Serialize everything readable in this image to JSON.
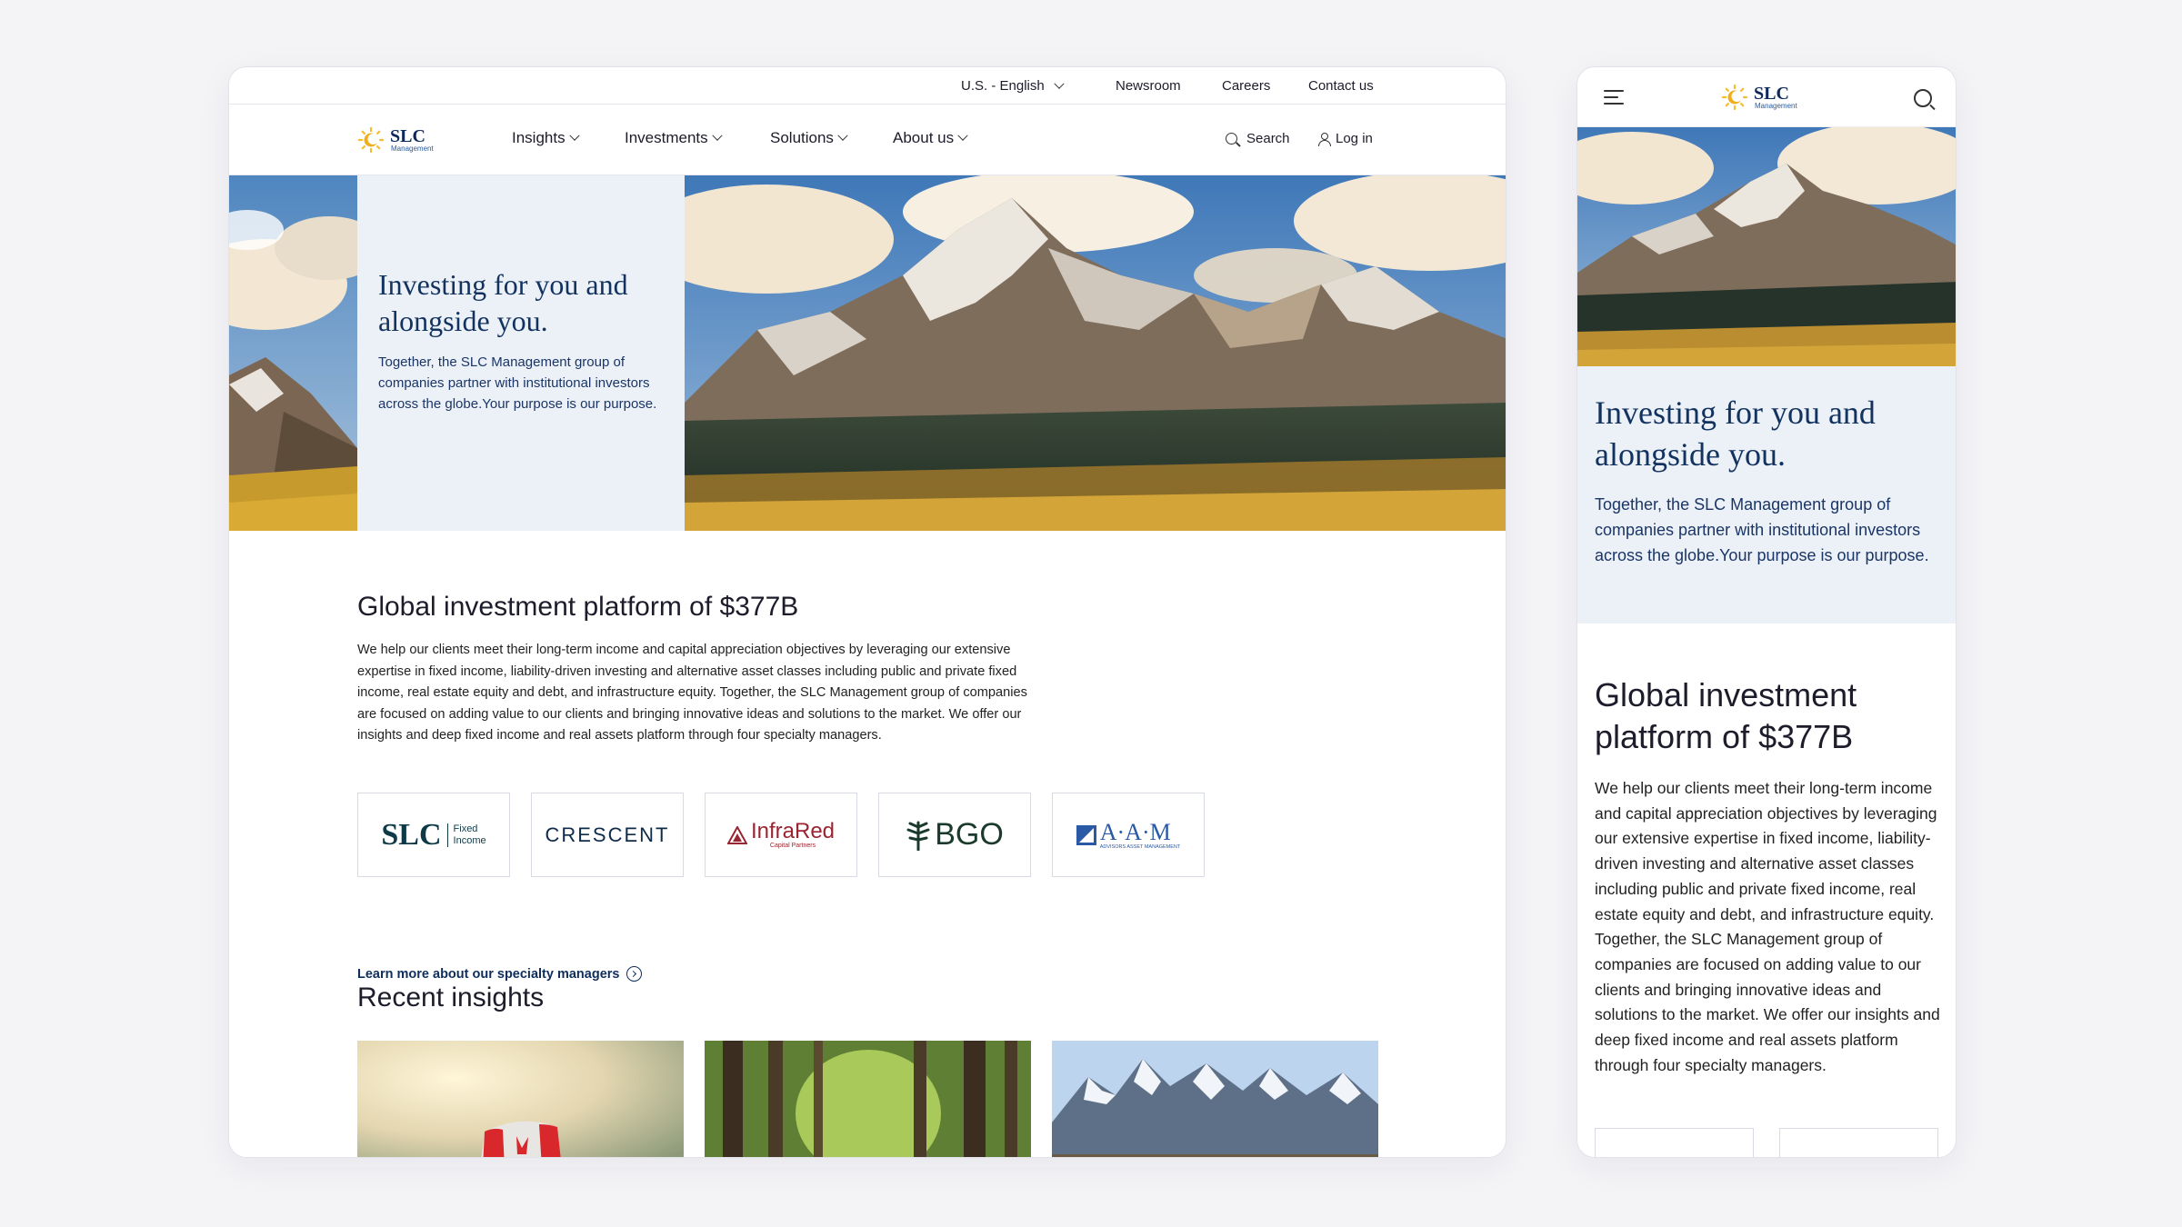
{
  "brand": {
    "name": "SLC",
    "subname": "Management"
  },
  "utility": {
    "language": "U.S. - English",
    "links": [
      "Newsroom",
      "Careers",
      "Contact us"
    ]
  },
  "nav": {
    "items": [
      "Insights",
      "Investments",
      "Solutions",
      "About us"
    ],
    "search_label": "Search",
    "login_label": "Log in"
  },
  "hero": {
    "title": "Investing for you and alongside you.",
    "text": "Together, the SLC Management group of companies partner with institutional investors across the globe.Your purpose is our purpose."
  },
  "platform": {
    "title": "Global investment platform of $377B",
    "text": "We help our clients meet their long-term income and capital appreciation objectives by leveraging our extensive expertise in fixed income, liability-driven investing and alternative asset classes including public and private fixed income, real estate equity and debt, and infrastructure equity. Together, the SLC Management group of companies are focused on adding value to our clients and bringing innovative ideas and solutions to the market. We offer our insights and deep fixed income and real assets platform through four specialty managers."
  },
  "managers": [
    {
      "name": "SLC",
      "sub1": "Fixed",
      "sub2": "Income"
    },
    {
      "name": "CRESCENT"
    },
    {
      "name": "InfraRed",
      "sub1": "Capital Partners"
    },
    {
      "name": "BGO"
    },
    {
      "name": "A·A·M",
      "sub1": "ADVISORS ASSET MANAGEMENT"
    }
  ],
  "learn_more": "Learn more about our specialty managers",
  "insights": {
    "title": "Recent insights"
  },
  "colors": {
    "navy": "#12325f",
    "panel": "#ecf1f8",
    "gold": "#f0b425"
  }
}
